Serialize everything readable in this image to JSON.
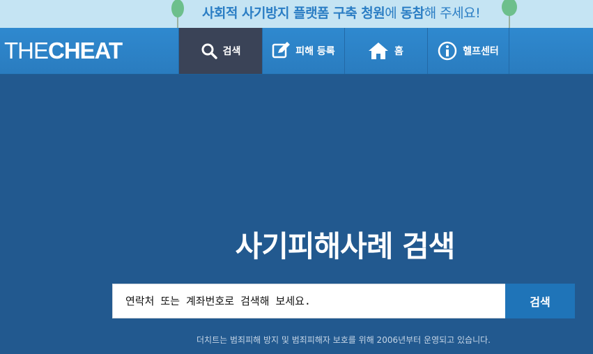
{
  "banner": {
    "part1": "사회적 사기방지 플랫폼 구축 청원",
    "part2": "에 ",
    "part3": "동참",
    "part4": "해 주세요!"
  },
  "nav": {
    "logo_thin": "THE",
    "logo_bold": "CHEAT",
    "items": [
      {
        "label": "검색",
        "icon": "search-icon"
      },
      {
        "label": "피해 등록",
        "icon": "edit-icon"
      },
      {
        "label": "홈",
        "icon": "home-icon"
      },
      {
        "label": "헬프센터",
        "icon": "info-icon"
      }
    ]
  },
  "hero": {
    "title": "사기피해사례 검색"
  },
  "search": {
    "placeholder": "연락처 또는 계좌번호로 검색해 보세요.",
    "button_label": "검색"
  },
  "footer": {
    "note": "더치트는 범죄피해 방지 및 범죄피해자 보호를 위해 2006년부터 운영되고 있습니다."
  },
  "colors": {
    "background": "#22598f",
    "banner": "#c5e4f3",
    "nav": "#2f89cf",
    "nav_active": "#3a4357",
    "button": "#1f74b8"
  }
}
